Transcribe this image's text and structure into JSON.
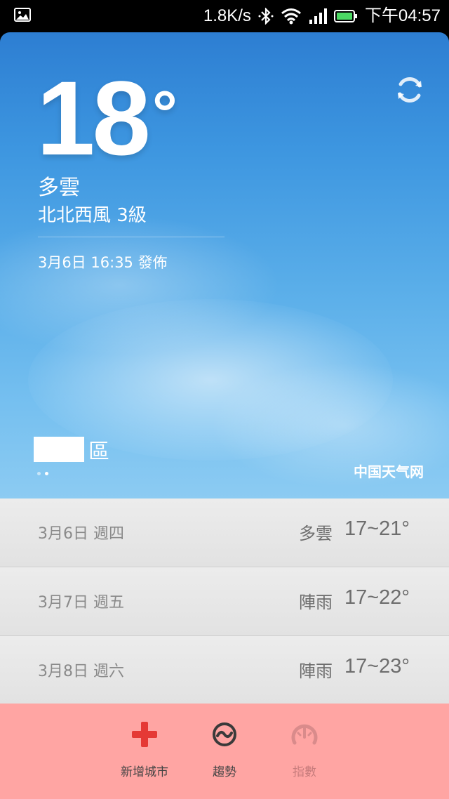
{
  "status_bar": {
    "net_speed": "1.8K/s",
    "time": "下午04:57"
  },
  "weather": {
    "temperature": "18",
    "degree": "°",
    "condition": "多雲",
    "wind": "北北西風 3級",
    "published": "3月6日 16:35 發佈",
    "city_suffix": "區",
    "source": "中国天气网",
    "page_count": 2,
    "active_page": 1
  },
  "forecast": [
    {
      "date": "3月6日  週四",
      "condition": "多雲",
      "range": "17~21°"
    },
    {
      "date": "3月7日  週五",
      "condition": "陣雨",
      "range": "17~22°"
    },
    {
      "date": "3月8日  週六",
      "condition": "陣雨",
      "range": "17~23°"
    }
  ],
  "bottom_bar": {
    "add_city": "新增城市",
    "trend": "趨勢",
    "index": "指數"
  },
  "colors": {
    "add_city_icon": "#e53935",
    "trend_icon": "#3a3a3a",
    "index_icon": "#d98b8b",
    "bottom_bg": "#ffa5a3"
  }
}
